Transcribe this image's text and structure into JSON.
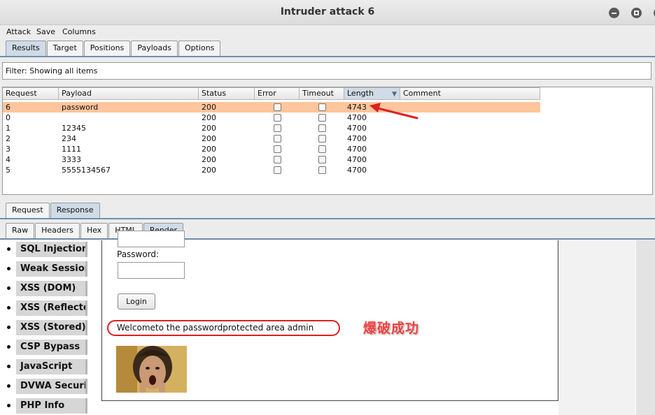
{
  "window": {
    "title": "Intruder attack 6"
  },
  "menu": [
    "Attack",
    "Save",
    "Columns"
  ],
  "main_tabs": [
    {
      "label": "Results",
      "active": true
    },
    {
      "label": "Target",
      "active": false
    },
    {
      "label": "Positions",
      "active": false
    },
    {
      "label": "Payloads",
      "active": false
    },
    {
      "label": "Options",
      "active": false
    }
  ],
  "filter": {
    "text": "Filter: Showing all items"
  },
  "results_table": {
    "columns": [
      "Request",
      "Payload",
      "Status",
      "Error",
      "Timeout",
      "Length",
      "Comment"
    ],
    "sorted_column": "Length",
    "rows": [
      {
        "request": "6",
        "payload": "password",
        "status": "200",
        "length": "4743",
        "selected": true
      },
      {
        "request": "0",
        "payload": "",
        "status": "200",
        "length": "4700",
        "selected": false
      },
      {
        "request": "1",
        "payload": "12345",
        "status": "200",
        "length": "4700",
        "selected": false
      },
      {
        "request": "2",
        "payload": "234",
        "status": "200",
        "length": "4700",
        "selected": false
      },
      {
        "request": "3",
        "payload": "1111",
        "status": "200",
        "length": "4700",
        "selected": false
      },
      {
        "request": "4",
        "payload": "3333",
        "status": "200",
        "length": "4700",
        "selected": false
      },
      {
        "request": "5",
        "payload": "5555134567",
        "status": "200",
        "length": "4700",
        "selected": false
      }
    ]
  },
  "message_tabs": [
    {
      "label": "Request",
      "active": false
    },
    {
      "label": "Response",
      "active": true
    }
  ],
  "view_tabs": [
    {
      "label": "Raw",
      "active": false
    },
    {
      "label": "Headers",
      "active": false
    },
    {
      "label": "Hex",
      "active": false
    },
    {
      "label": "HTML",
      "active": false
    },
    {
      "label": "Render",
      "active": true
    }
  ],
  "rendered_page": {
    "sidebar": [
      "SQL Injection",
      "Weak Session IDs",
      "XSS (DOM)",
      "XSS (Reflected)",
      "XSS (Stored)",
      "CSP Bypass",
      "JavaScript",
      "DVWA Security",
      "PHP Info"
    ],
    "password_label": "Password:",
    "login_button": "Login",
    "welcome_text": "Welcometo the passwordprotected area admin"
  },
  "annotation": {
    "text": "爆破成功",
    "color": "#f04040"
  },
  "colors": {
    "selected_row": "#ffc59c",
    "active_tab": "#cfdbe6",
    "highlight_red": "#e02020"
  }
}
